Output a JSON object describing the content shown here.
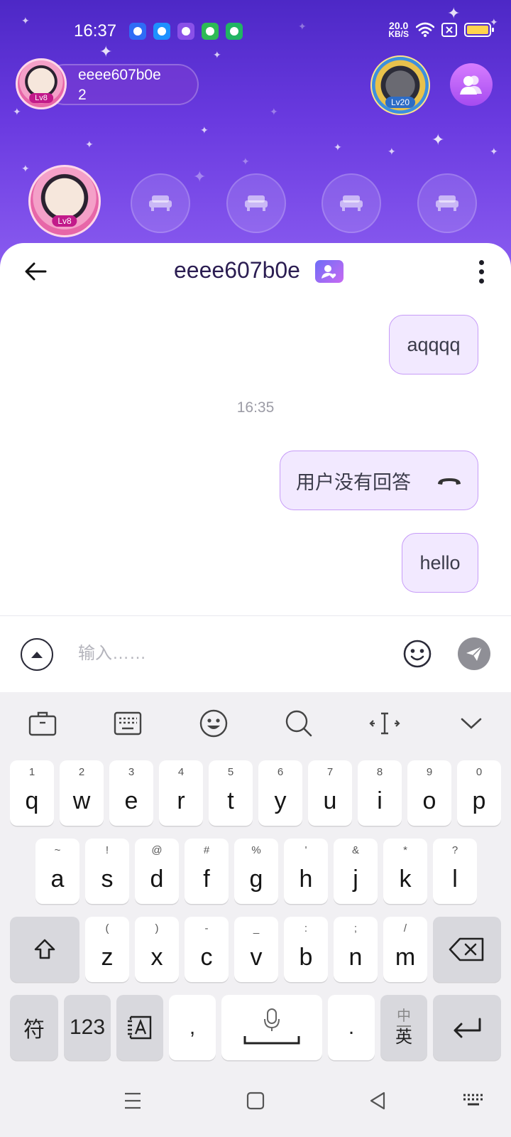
{
  "status_bar": {
    "time": "16:37",
    "net_speed_value": "20.0",
    "net_speed_unit": "KB/S",
    "battery_level": 0.9
  },
  "room": {
    "owner_name": "eeee607b0e",
    "owner_count": "2",
    "owner_level": "Lv8",
    "rank_level": "Lv20",
    "seat_owner_level": "Lv8",
    "empty_seats": 4
  },
  "chat": {
    "title": "eeee607b0e",
    "timestamp": "16:35",
    "messages": [
      {
        "text": "aqqqq",
        "direction": "outgoing"
      },
      {
        "text": "用户没有回答",
        "direction": "outgoing",
        "icon": "phone-hangup-icon"
      },
      {
        "text": "hello",
        "direction": "outgoing"
      }
    ],
    "input_placeholder": "输入……"
  },
  "keyboard": {
    "row1": [
      {
        "hint": "1",
        "key": "q"
      },
      {
        "hint": "2",
        "key": "w"
      },
      {
        "hint": "3",
        "key": "e"
      },
      {
        "hint": "4",
        "key": "r"
      },
      {
        "hint": "5",
        "key": "t"
      },
      {
        "hint": "6",
        "key": "y"
      },
      {
        "hint": "7",
        "key": "u"
      },
      {
        "hint": "8",
        "key": "i"
      },
      {
        "hint": "9",
        "key": "o"
      },
      {
        "hint": "0",
        "key": "p"
      }
    ],
    "row2": [
      {
        "hint": "~",
        "key": "a"
      },
      {
        "hint": "!",
        "key": "s"
      },
      {
        "hint": "@",
        "key": "d"
      },
      {
        "hint": "#",
        "key": "f"
      },
      {
        "hint": "%",
        "key": "g"
      },
      {
        "hint": "'",
        "key": "h"
      },
      {
        "hint": "&",
        "key": "j"
      },
      {
        "hint": "*",
        "key": "k"
      },
      {
        "hint": "?",
        "key": "l"
      }
    ],
    "row3": [
      {
        "hint": "(",
        "key": "z"
      },
      {
        "hint": ")",
        "key": "x"
      },
      {
        "hint": "-",
        "key": "c"
      },
      {
        "hint": "_",
        "key": "v"
      },
      {
        "hint": ":",
        "key": "b"
      },
      {
        "hint": ";",
        "key": "n"
      },
      {
        "hint": "/",
        "key": "m"
      }
    ],
    "symbols_label": "符",
    "numbers_label": "123",
    "comma_label": ",",
    "period_label": ".",
    "lang_top": "中",
    "lang_bottom": "英"
  },
  "colors": {
    "room_top": "#4d28c6",
    "room_bottom": "#8a5cf0",
    "bubble_bg": "#f2e9ff",
    "bubble_border": "#c79cf8",
    "title_color": "#2b1d52"
  }
}
